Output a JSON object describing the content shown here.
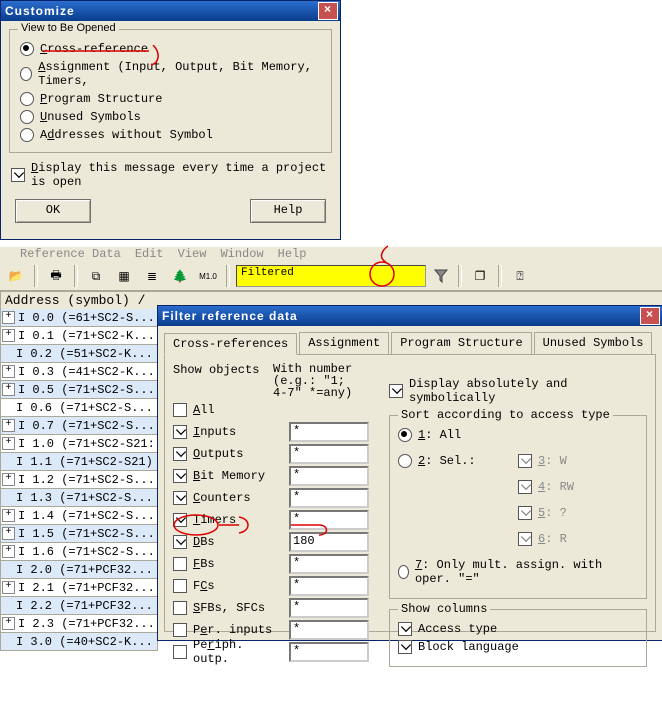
{
  "customize": {
    "title": "Customize",
    "group_legend": "View to Be Opened",
    "radios": [
      {
        "label_u": "C",
        "label": "ross-reference",
        "checked": true
      },
      {
        "label_u": "A",
        "label": "ssignment (Input, Output, Bit Memory, Timers,",
        "checked": false
      },
      {
        "label_u": "P",
        "label": "rogram Structure",
        "checked": false
      },
      {
        "label_u": "U",
        "label": "nused Symbols",
        "checked": false
      },
      {
        "label": "Addresses without Symbol",
        "label_pre": "A",
        "label_u": "d",
        "label_post": "dresses without Symbol",
        "checked": false
      }
    ],
    "chk_display_u": "D",
    "chk_display": "isplay this message every time a project is open",
    "chk_display_checked": true,
    "ok": "OK",
    "help": "Help"
  },
  "menubar": {
    "items": [
      "Reference Data",
      "Edit",
      "View",
      "Window",
      "Help"
    ]
  },
  "toolbar": {
    "filter_value": "Filtered"
  },
  "addr_header": "Address (symbol) /",
  "addr_list": [
    {
      "pm": "+",
      "txt": "I 0.0 (=61+SC2-S...",
      "alt": true
    },
    {
      "pm": "+",
      "txt": "I 0.1 (=71+SC2-K...",
      "alt": false
    },
    {
      "pm": "",
      "txt": "I 0.2 (=51+SC2-K...",
      "alt": true
    },
    {
      "pm": "+",
      "txt": "I 0.3 (=41+SC2-K...",
      "alt": false
    },
    {
      "pm": "+",
      "txt": "I 0.5 (=71+SC2-S...",
      "alt": true
    },
    {
      "pm": "",
      "txt": "I 0.6 (=71+SC2-S...",
      "alt": false
    },
    {
      "pm": "+",
      "txt": "I 0.7 (=71+SC2-S...",
      "alt": true
    },
    {
      "pm": "+",
      "txt": "I 1.0 (=71+SC2-S21:",
      "alt": false
    },
    {
      "pm": "",
      "txt": "I 1.1 (=71+SC2-S21)",
      "alt": true
    },
    {
      "pm": "+",
      "txt": "I 1.2 (=71+SC2-S...",
      "alt": false
    },
    {
      "pm": "",
      "txt": "I 1.3 (=71+SC2-S...",
      "alt": true
    },
    {
      "pm": "+",
      "txt": "I 1.4 (=71+SC2-S...",
      "alt": false
    },
    {
      "pm": "+",
      "txt": "I 1.5 (=71+SC2-S...",
      "alt": true
    },
    {
      "pm": "+",
      "txt": "I 1.6 (=71+SC2-S...",
      "alt": false
    },
    {
      "pm": "",
      "txt": "I 2.0 (=71+PCF32...",
      "alt": true
    },
    {
      "pm": "+",
      "txt": "I 2.1 (=71+PCF32...",
      "alt": false
    },
    {
      "pm": "",
      "txt": "I 2.2 (=71+PCF32...",
      "alt": true
    },
    {
      "pm": "+",
      "txt": "I 2.3 (=71+PCF32...",
      "alt": false
    },
    {
      "pm": "",
      "txt": "I 3.0 (=40+SC2-K...",
      "alt": true
    }
  ],
  "filter": {
    "title": "Filter reference data",
    "tabs": [
      "Cross-references",
      "Assignment",
      "Program Structure",
      "Unused Symbols"
    ],
    "show_objects_label": "Show objects",
    "withnum_label_1": "With number",
    "withnum_label_2": "(e.g.: \"1;",
    "withnum_label_3": "4-7\" *=any)",
    "objs": [
      {
        "name": "all",
        "u": "A",
        "label": "ll",
        "chk": false,
        "num": ""
      },
      {
        "name": "inputs",
        "u": "I",
        "label": "nputs",
        "chk": true,
        "num": "*"
      },
      {
        "name": "outputs",
        "u": "O",
        "label": "utputs",
        "chk": true,
        "num": "*"
      },
      {
        "name": "bitmemory",
        "u": "B",
        "label": "it Memory",
        "chk": true,
        "num": "*"
      },
      {
        "name": "counters",
        "u": "C",
        "label": "ounters",
        "chk": true,
        "num": "*"
      },
      {
        "name": "timers",
        "u": "T",
        "label": "imers",
        "chk": true,
        "num": "*"
      },
      {
        "name": "dbs",
        "u": "D",
        "label": "Bs",
        "chk": true,
        "num": "180"
      },
      {
        "name": "fbs",
        "u": "F",
        "label": "Bs",
        "chk": false,
        "num": "*"
      },
      {
        "name": "fcs",
        "label_pre": "F",
        "u": "C",
        "label": "s",
        "chk": false,
        "num": "*"
      },
      {
        "name": "sfbs",
        "u": "S",
        "label": "FBs, SFCs",
        "chk": false,
        "num": "*"
      },
      {
        "name": "perinp",
        "label_pre": "P",
        "u": "e",
        "label": "r. inputs",
        "chk": false,
        "num": "*"
      },
      {
        "name": "peroutp",
        "label_pre": "Pe",
        "u": "r",
        "label": "iph. outp.",
        "chk": false,
        "num": "*"
      }
    ],
    "display_abs_sym": "Display absolutely and symbolically",
    "display_abs_sym_chk": true,
    "sort_legend": "Sort according to access type",
    "sort": {
      "r1": {
        "u": "1",
        "label": ": All",
        "chk": true
      },
      "r2": {
        "u": "2",
        "label": ": Sel.:",
        "chk": false
      },
      "c3": {
        "u": "3",
        "label": ": W"
      },
      "c4": {
        "u": "4",
        "label": ": RW"
      },
      "c5": {
        "u": "5",
        "label": ": ?"
      },
      "c6": {
        "u": "6",
        "label": ": R"
      },
      "r7": {
        "u": "7",
        "label": ": Only mult. assign. with oper. \"=\"",
        "chk": false
      }
    },
    "cols_legend": "Show columns",
    "col_access": "Access type",
    "col_block": "Block language"
  }
}
